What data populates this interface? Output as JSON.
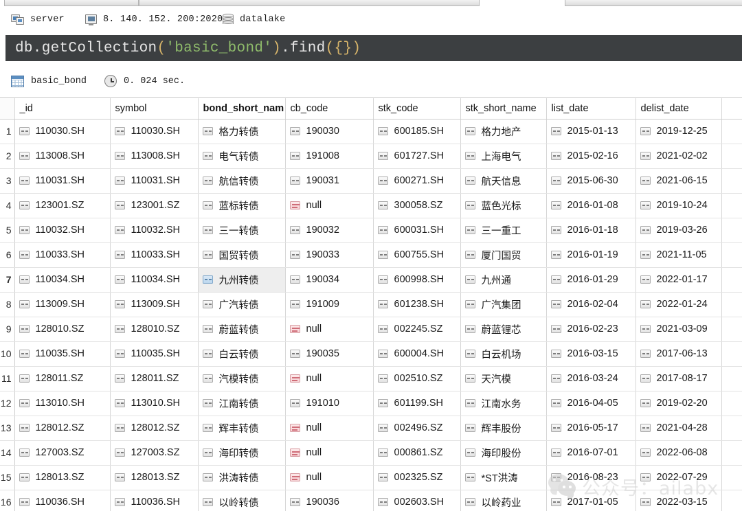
{
  "window": {
    "tabs": [
      "",
      "",
      ""
    ]
  },
  "connection": {
    "server": {
      "icon": "server-icon",
      "label": "server"
    },
    "host": {
      "icon": "monitor-icon",
      "label": "8. 140. 152. 200:2020"
    },
    "database": {
      "icon": "database-icon",
      "label": "datalake"
    }
  },
  "query": {
    "tokens": [
      {
        "text": "db.getCollection",
        "type": "plain"
      },
      {
        "text": "(",
        "type": "punct"
      },
      {
        "text": "'basic_bond'",
        "type": "string"
      },
      {
        "text": ")",
        "type": "punct"
      },
      {
        "text": ".find",
        "type": "plain"
      },
      {
        "text": "(",
        "type": "punct"
      },
      {
        "text": "{}",
        "type": "punct"
      },
      {
        "text": ")",
        "type": "punct"
      }
    ],
    "plain_text": "db.getCollection('basic_bond').find({})",
    "background": "#3c3f41",
    "string_color": "#8fbc6b",
    "punct_color": "#d8b56a"
  },
  "result_bar": {
    "table_icon": "grid-icon",
    "table_name": "basic_bond",
    "clock_icon": "clock-icon",
    "elapsed": "0. 024 sec."
  },
  "table": {
    "columns": [
      {
        "key": "_id",
        "label": "_id",
        "sorted": false
      },
      {
        "key": "symbol",
        "label": "symbol",
        "sorted": false
      },
      {
        "key": "bond_short_name",
        "label": "bond_short_nam",
        "sorted": true
      },
      {
        "key": "cb_code",
        "label": "cb_code",
        "sorted": false
      },
      {
        "key": "stk_code",
        "label": "stk_code",
        "sorted": false
      },
      {
        "key": "stk_short_name",
        "label": "stk_short_name",
        "sorted": false
      },
      {
        "key": "list_date",
        "label": "list_date",
        "sorted": false
      },
      {
        "key": "delist_date",
        "label": "delist_date",
        "sorted": false
      }
    ],
    "selected_row": 7,
    "selected_column": "bond_short_name",
    "rows": [
      {
        "n": "1",
        "_id": "110030.SH",
        "symbol": "110030.SH",
        "bond_short_name": "格力转债",
        "cb_code": "190030",
        "stk_code": "600185.SH",
        "stk_short_name": "格力地产",
        "list_date": "2015-01-13",
        "delist_date": "2019-12-25"
      },
      {
        "n": "2",
        "_id": "113008.SH",
        "symbol": "113008.SH",
        "bond_short_name": "电气转债",
        "cb_code": "191008",
        "stk_code": "601727.SH",
        "stk_short_name": "上海电气",
        "list_date": "2015-02-16",
        "delist_date": "2021-02-02"
      },
      {
        "n": "3",
        "_id": "110031.SH",
        "symbol": "110031.SH",
        "bond_short_name": "航信转债",
        "cb_code": "190031",
        "stk_code": "600271.SH",
        "stk_short_name": "航天信息",
        "list_date": "2015-06-30",
        "delist_date": "2021-06-15"
      },
      {
        "n": "4",
        "_id": "123001.SZ",
        "symbol": "123001.SZ",
        "bond_short_name": "蓝标转债",
        "cb_code": "null",
        "stk_code": "300058.SZ",
        "stk_short_name": "蓝色光标",
        "list_date": "2016-01-08",
        "delist_date": "2019-10-24"
      },
      {
        "n": "5",
        "_id": "110032.SH",
        "symbol": "110032.SH",
        "bond_short_name": "三一转债",
        "cb_code": "190032",
        "stk_code": "600031.SH",
        "stk_short_name": "三一重工",
        "list_date": "2016-01-18",
        "delist_date": "2019-03-26"
      },
      {
        "n": "6",
        "_id": "110033.SH",
        "symbol": "110033.SH",
        "bond_short_name": "国贸转债",
        "cb_code": "190033",
        "stk_code": "600755.SH",
        "stk_short_name": "厦门国贸",
        "list_date": "2016-01-19",
        "delist_date": "2021-11-05"
      },
      {
        "n": "7",
        "_id": "110034.SH",
        "symbol": "110034.SH",
        "bond_short_name": "九州转债",
        "cb_code": "190034",
        "stk_code": "600998.SH",
        "stk_short_name": "九州通",
        "list_date": "2016-01-29",
        "delist_date": "2022-01-17"
      },
      {
        "n": "8",
        "_id": "113009.SH",
        "symbol": "113009.SH",
        "bond_short_name": "广汽转债",
        "cb_code": "191009",
        "stk_code": "601238.SH",
        "stk_short_name": "广汽集团",
        "list_date": "2016-02-04",
        "delist_date": "2022-01-24"
      },
      {
        "n": "9",
        "_id": "128010.SZ",
        "symbol": "128010.SZ",
        "bond_short_name": "蔚蓝转债",
        "cb_code": "null",
        "stk_code": "002245.SZ",
        "stk_short_name": "蔚蓝锂芯",
        "list_date": "2016-02-23",
        "delist_date": "2021-03-09"
      },
      {
        "n": "10",
        "_id": "110035.SH",
        "symbol": "110035.SH",
        "bond_short_name": "白云转债",
        "cb_code": "190035",
        "stk_code": "600004.SH",
        "stk_short_name": "白云机场",
        "list_date": "2016-03-15",
        "delist_date": "2017-06-13"
      },
      {
        "n": "11",
        "_id": "128011.SZ",
        "symbol": "128011.SZ",
        "bond_short_name": "汽模转债",
        "cb_code": "null",
        "stk_code": "002510.SZ",
        "stk_short_name": "天汽模",
        "list_date": "2016-03-24",
        "delist_date": "2017-08-17"
      },
      {
        "n": "12",
        "_id": "113010.SH",
        "symbol": "113010.SH",
        "bond_short_name": "江南转债",
        "cb_code": "191010",
        "stk_code": "601199.SH",
        "stk_short_name": "江南水务",
        "list_date": "2016-04-05",
        "delist_date": "2019-02-20"
      },
      {
        "n": "13",
        "_id": "128012.SZ",
        "symbol": "128012.SZ",
        "bond_short_name": "辉丰转债",
        "cb_code": "null",
        "stk_code": "002496.SZ",
        "stk_short_name": "辉丰股份",
        "list_date": "2016-05-17",
        "delist_date": "2021-04-28"
      },
      {
        "n": "14",
        "_id": "127003.SZ",
        "symbol": "127003.SZ",
        "bond_short_name": "海印转债",
        "cb_code": "null",
        "stk_code": "000861.SZ",
        "stk_short_name": "海印股份",
        "list_date": "2016-07-01",
        "delist_date": "2022-06-08"
      },
      {
        "n": "15",
        "_id": "128013.SZ",
        "symbol": "128013.SZ",
        "bond_short_name": "洪涛转债",
        "cb_code": "null",
        "stk_code": "002325.SZ",
        "stk_short_name": "*ST洪涛",
        "list_date": "2016-08-23",
        "delist_date": "2022-07-29"
      },
      {
        "n": "16",
        "_id": "110036.SH",
        "symbol": "110036.SH",
        "bond_short_name": "以岭转债",
        "cb_code": "190036",
        "stk_code": "002603.SH",
        "stk_short_name": "以岭药业",
        "list_date": "2017-01-05",
        "delist_date": "2022-03-15"
      }
    ]
  },
  "watermark": {
    "logo": "wechat-icon",
    "text": "公众号：ailabx"
  }
}
